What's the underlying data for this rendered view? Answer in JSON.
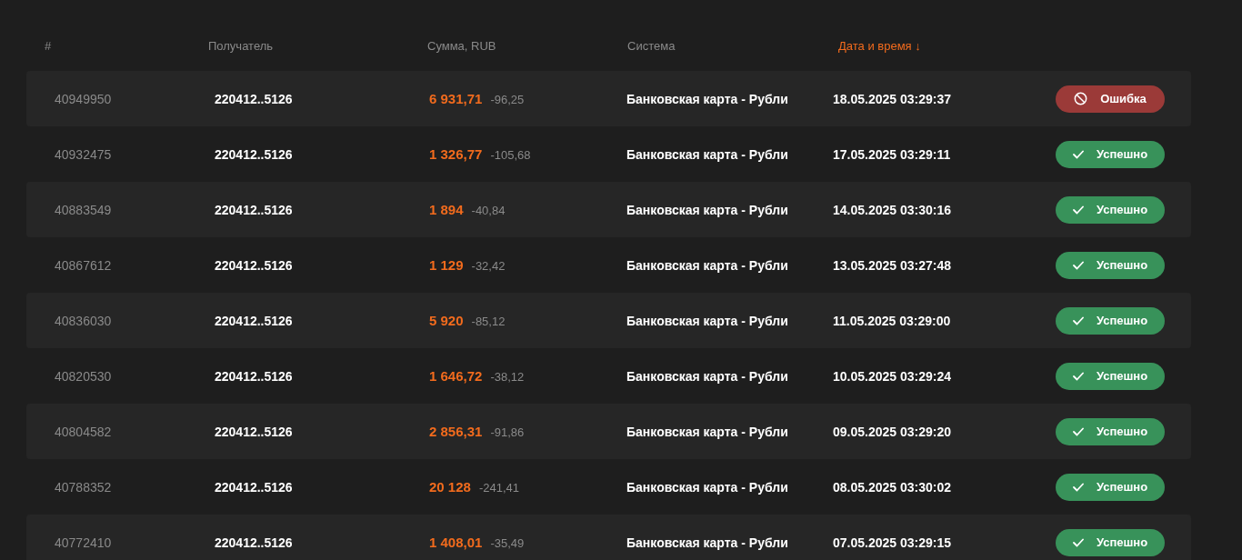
{
  "table": {
    "columns": [
      {
        "label": "#",
        "sorted": false
      },
      {
        "label": "Получатель",
        "sorted": false
      },
      {
        "label": "Сумма, RUB",
        "sorted": false
      },
      {
        "label": "Система",
        "sorted": false
      },
      {
        "label": "Дата и время",
        "sorted": true,
        "sort_arrow": "↓"
      }
    ],
    "rows": [
      {
        "id": "40949950",
        "recipient": "220412..5126",
        "amount": "6 931,71",
        "fee": "-96,25",
        "system": "Банковская карта - Рубли",
        "datetime": "18.05.2025 03:29:37",
        "status": {
          "kind": "error",
          "label": "Ошибка"
        }
      },
      {
        "id": "40932475",
        "recipient": "220412..5126",
        "amount": "1 326,77",
        "fee": "-105,68",
        "system": "Банковская карта - Рубли",
        "datetime": "17.05.2025 03:29:11",
        "status": {
          "kind": "success",
          "label": "Успешно"
        }
      },
      {
        "id": "40883549",
        "recipient": "220412..5126",
        "amount": "1 894",
        "fee": "-40,84",
        "system": "Банковская карта - Рубли",
        "datetime": "14.05.2025 03:30:16",
        "status": {
          "kind": "success",
          "label": "Успешно"
        }
      },
      {
        "id": "40867612",
        "recipient": "220412..5126",
        "amount": "1 129",
        "fee": "-32,42",
        "system": "Банковская карта - Рубли",
        "datetime": "13.05.2025 03:27:48",
        "status": {
          "kind": "success",
          "label": "Успешно"
        }
      },
      {
        "id": "40836030",
        "recipient": "220412..5126",
        "amount": "5 920",
        "fee": "-85,12",
        "system": "Банковская карта - Рубли",
        "datetime": "11.05.2025 03:29:00",
        "status": {
          "kind": "success",
          "label": "Успешно"
        }
      },
      {
        "id": "40820530",
        "recipient": "220412..5126",
        "amount": "1 646,72",
        "fee": "-38,12",
        "system": "Банковская карта - Рубли",
        "datetime": "10.05.2025 03:29:24",
        "status": {
          "kind": "success",
          "label": "Успешно"
        }
      },
      {
        "id": "40804582",
        "recipient": "220412..5126",
        "amount": "2 856,31",
        "fee": "-91,86",
        "system": "Банковская карта - Рубли",
        "datetime": "09.05.2025 03:29:20",
        "status": {
          "kind": "success",
          "label": "Успешно"
        }
      },
      {
        "id": "40788352",
        "recipient": "220412..5126",
        "amount": "20 128",
        "fee": "-241,41",
        "system": "Банковская карта - Рубли",
        "datetime": "08.05.2025 03:30:02",
        "status": {
          "kind": "success",
          "label": "Успешно"
        }
      },
      {
        "id": "40772410",
        "recipient": "220412..5126",
        "amount": "1 408,01",
        "fee": "-35,49",
        "system": "Банковская карта - Рубли",
        "datetime": "07.05.2025 03:29:15",
        "status": {
          "kind": "success",
          "label": "Успешно"
        }
      }
    ]
  }
}
